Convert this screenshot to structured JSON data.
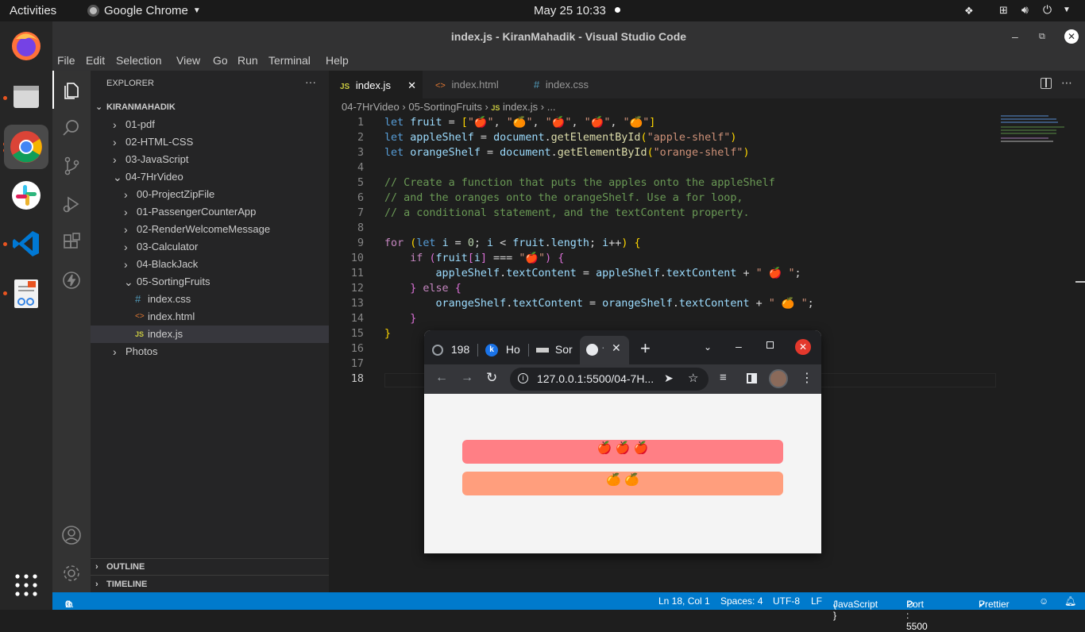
{
  "topbar": {
    "activities": "Activities",
    "app": "Google Chrome",
    "clock": "May 25  10:33"
  },
  "dock": {
    "apps": [
      "firefox-icon",
      "files-icon",
      "chrome-icon",
      "slack-icon",
      "vscode-icon",
      "text-editor-icon"
    ]
  },
  "window": {
    "title": "index.js - KiranMahadik - Visual Studio Code"
  },
  "menu": [
    "File",
    "Edit",
    "Selection",
    "View",
    "Go",
    "Run",
    "Terminal",
    "Help"
  ],
  "explorer": {
    "title": "EXPLORER",
    "more": "···",
    "root": "KIRANMAHADIK",
    "items": [
      {
        "label": "01-pdf",
        "kind": "folder",
        "open": false,
        "depth": 1
      },
      {
        "label": "02-HTML-CSS",
        "kind": "folder",
        "open": false,
        "depth": 1
      },
      {
        "label": "03-JavaScript",
        "kind": "folder",
        "open": false,
        "depth": 1
      },
      {
        "label": "04-7HrVideo",
        "kind": "folder",
        "open": true,
        "depth": 1
      },
      {
        "label": "00-ProjectZipFile",
        "kind": "folder",
        "open": false,
        "depth": 2
      },
      {
        "label": "01-PassengerCounterApp",
        "kind": "folder",
        "open": false,
        "depth": 2
      },
      {
        "label": "02-RenderWelcomeMessage",
        "kind": "folder",
        "open": false,
        "depth": 2
      },
      {
        "label": "03-Calculator",
        "kind": "folder",
        "open": false,
        "depth": 2
      },
      {
        "label": "04-BlackJack",
        "kind": "folder",
        "open": false,
        "depth": 2
      },
      {
        "label": "05-SortingFruits",
        "kind": "folder",
        "open": true,
        "depth": 2
      },
      {
        "label": "index.css",
        "kind": "css",
        "depth": 3
      },
      {
        "label": "index.html",
        "kind": "html",
        "depth": 3
      },
      {
        "label": "index.js",
        "kind": "js",
        "depth": 3,
        "selected": true
      },
      {
        "label": "Photos",
        "kind": "folder",
        "open": false,
        "depth": 1
      }
    ],
    "outline": "OUTLINE",
    "timeline": "TIMELINE"
  },
  "tabs": [
    {
      "label": "index.js",
      "icon": "JS",
      "active": true
    },
    {
      "label": "index.html",
      "icon": "<>",
      "active": false
    },
    {
      "label": "index.css",
      "icon": "#",
      "active": false
    }
  ],
  "breadcrumb": [
    "04-7HrVideo",
    "05-SortingFruits",
    "index.js",
    "..."
  ],
  "code": {
    "line_numbers": [
      "1",
      "2",
      "3",
      "4",
      "5",
      "6",
      "7",
      "8",
      "9",
      "10",
      "11",
      "12",
      "13",
      "14",
      "15",
      "16",
      "17",
      "18"
    ]
  },
  "statusbar": {
    "errors": "0",
    "warnings": "0",
    "position": "Ln 18, Col 1",
    "spaces": "Spaces: 4",
    "encoding": "UTF-8",
    "eol": "LF",
    "language": "JavaScript",
    "port": "Port : 5500",
    "prettier": "Prettier"
  },
  "browser": {
    "tabs": [
      "198",
      "Ho",
      "Sor",
      "·"
    ],
    "url": "127.0.0.1:5500/04-7H...",
    "apple_shelf": "🍎 🍎 🍎",
    "orange_shelf": "🍊 🍊",
    "apple_color": "#ff7f85",
    "orange_color": "#ff9e7d"
  },
  "colors": {
    "statusbar": "#007acc",
    "editor_bg": "#1e1e1e",
    "sidebar_bg": "#252526"
  }
}
